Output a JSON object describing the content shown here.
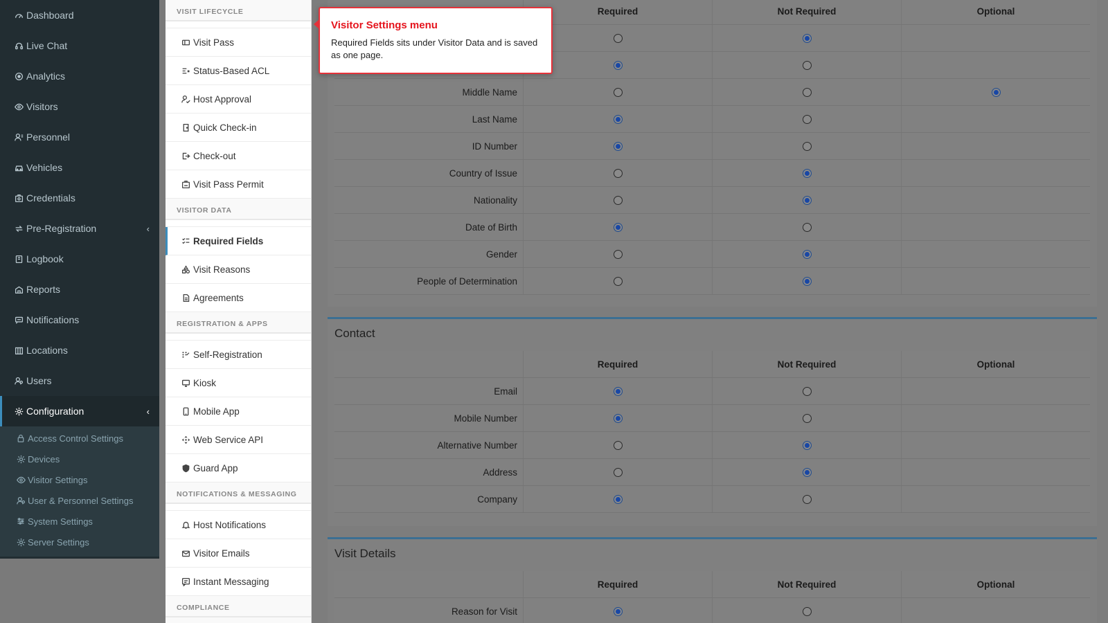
{
  "sidebar": {
    "items": [
      {
        "label": "Dashboard",
        "icon": "dashboard-icon"
      },
      {
        "label": "Live Chat",
        "icon": "headset-icon"
      },
      {
        "label": "Analytics",
        "icon": "analytics-icon"
      },
      {
        "label": "Visitors",
        "icon": "eye-icon"
      },
      {
        "label": "Personnel",
        "icon": "personnel-icon"
      },
      {
        "label": "Vehicles",
        "icon": "car-icon"
      },
      {
        "label": "Credentials",
        "icon": "badge-icon"
      },
      {
        "label": "Pre-Registration",
        "icon": "arrows-icon"
      },
      {
        "label": "Logbook",
        "icon": "book-icon"
      },
      {
        "label": "Reports",
        "icon": "reports-icon"
      },
      {
        "label": "Notifications",
        "icon": "chat-icon"
      },
      {
        "label": "Locations",
        "icon": "map-icon"
      },
      {
        "label": "Users",
        "icon": "users-icon"
      },
      {
        "label": "Configuration",
        "icon": "gear-icon"
      }
    ],
    "submenu": [
      {
        "label": "Access Control Settings",
        "icon": "lock-icon"
      },
      {
        "label": "Devices",
        "icon": "gear-icon"
      },
      {
        "label": "Visitor Settings",
        "icon": "eye-icon"
      },
      {
        "label": "User & Personnel Settings",
        "icon": "users-icon"
      },
      {
        "label": "System Settings",
        "icon": "sliders-icon"
      },
      {
        "label": "Server Settings",
        "icon": "gear-icon"
      }
    ]
  },
  "settings_menu": {
    "sections": [
      {
        "title": "VISIT LIFECYCLE",
        "items": [
          "Visit Pass",
          "Status-Based ACL",
          "Host Approval",
          "Quick Check-in",
          "Check-out",
          "Visit Pass Permit"
        ]
      },
      {
        "title": "VISITOR DATA",
        "items": [
          "Required Fields",
          "Visit Reasons",
          "Agreements"
        ]
      },
      {
        "title": "REGISTRATION & APPS",
        "items": [
          "Self-Registration",
          "Kiosk",
          "Mobile App",
          "Web Service API",
          "Guard App"
        ]
      },
      {
        "title": "NOTIFICATIONS & MESSAGING",
        "items": [
          "Host Notifications",
          "Visitor Emails",
          "Instant Messaging"
        ]
      },
      {
        "title": "COMPLIANCE",
        "items": []
      }
    ],
    "active_item": "Required Fields"
  },
  "table_headers": {
    "required": "Required",
    "not_required": "Not Required",
    "optional": "Optional"
  },
  "panels": {
    "personal": {
      "rows": [
        {
          "label": "",
          "value": "not_required"
        },
        {
          "label": "",
          "value": "required"
        },
        {
          "label": "Middle Name",
          "value": "optional"
        },
        {
          "label": "Last Name",
          "value": "required"
        },
        {
          "label": "ID Number",
          "value": "required"
        },
        {
          "label": "Country of Issue",
          "value": "not_required"
        },
        {
          "label": "Nationality",
          "value": "not_required"
        },
        {
          "label": "Date of Birth",
          "value": "required"
        },
        {
          "label": "Gender",
          "value": "not_required"
        },
        {
          "label": "People of Determination",
          "value": "not_required"
        }
      ]
    },
    "contact": {
      "title": "Contact",
      "rows": [
        {
          "label": "Email",
          "value": "required"
        },
        {
          "label": "Mobile Number",
          "value": "required"
        },
        {
          "label": "Alternative Number",
          "value": "not_required"
        },
        {
          "label": "Address",
          "value": "not_required"
        },
        {
          "label": "Company",
          "value": "required"
        }
      ]
    },
    "visit": {
      "title": "Visit Details",
      "rows": [
        {
          "label": "Reason for Visit",
          "value": "required"
        }
      ]
    }
  },
  "tooltip": {
    "title": "Visitor Settings menu",
    "body": "Required Fields sits under Visitor Data and is saved as one page."
  },
  "colors": {
    "sidebar_bg": "#222d32",
    "accent": "#3c8dbc",
    "tooltip_border": "#e5323a",
    "radio_on": "#1947a5"
  }
}
